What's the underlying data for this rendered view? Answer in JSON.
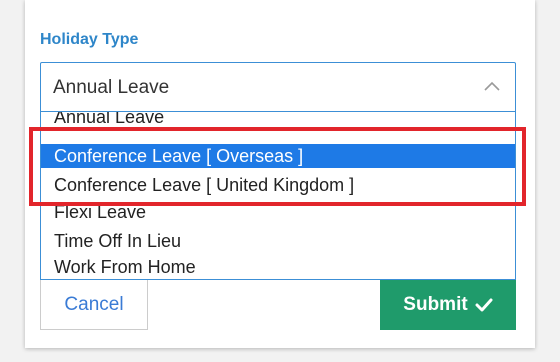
{
  "form": {
    "holiday_type_label": "Holiday Type",
    "select": {
      "value": "Annual Leave",
      "icon": "chevron-up-icon"
    },
    "options": [
      "Annual Leave",
      "Conference Leave [ Overseas ]",
      "Conference Leave [ United Kingdom ]",
      "Flexi Leave",
      "Time Off In Lieu",
      "Work From Home"
    ],
    "highlighted_option": "Conference Leave [ Overseas ]"
  },
  "actions": {
    "cancel_label": "Cancel",
    "submit_label": "Submit",
    "submit_icon": "check-icon"
  },
  "colors": {
    "label": "#2e86c9",
    "selected_bg": "#1e7ae6",
    "submit_bg": "#1f9b6b",
    "annotation": "#e2252b"
  }
}
